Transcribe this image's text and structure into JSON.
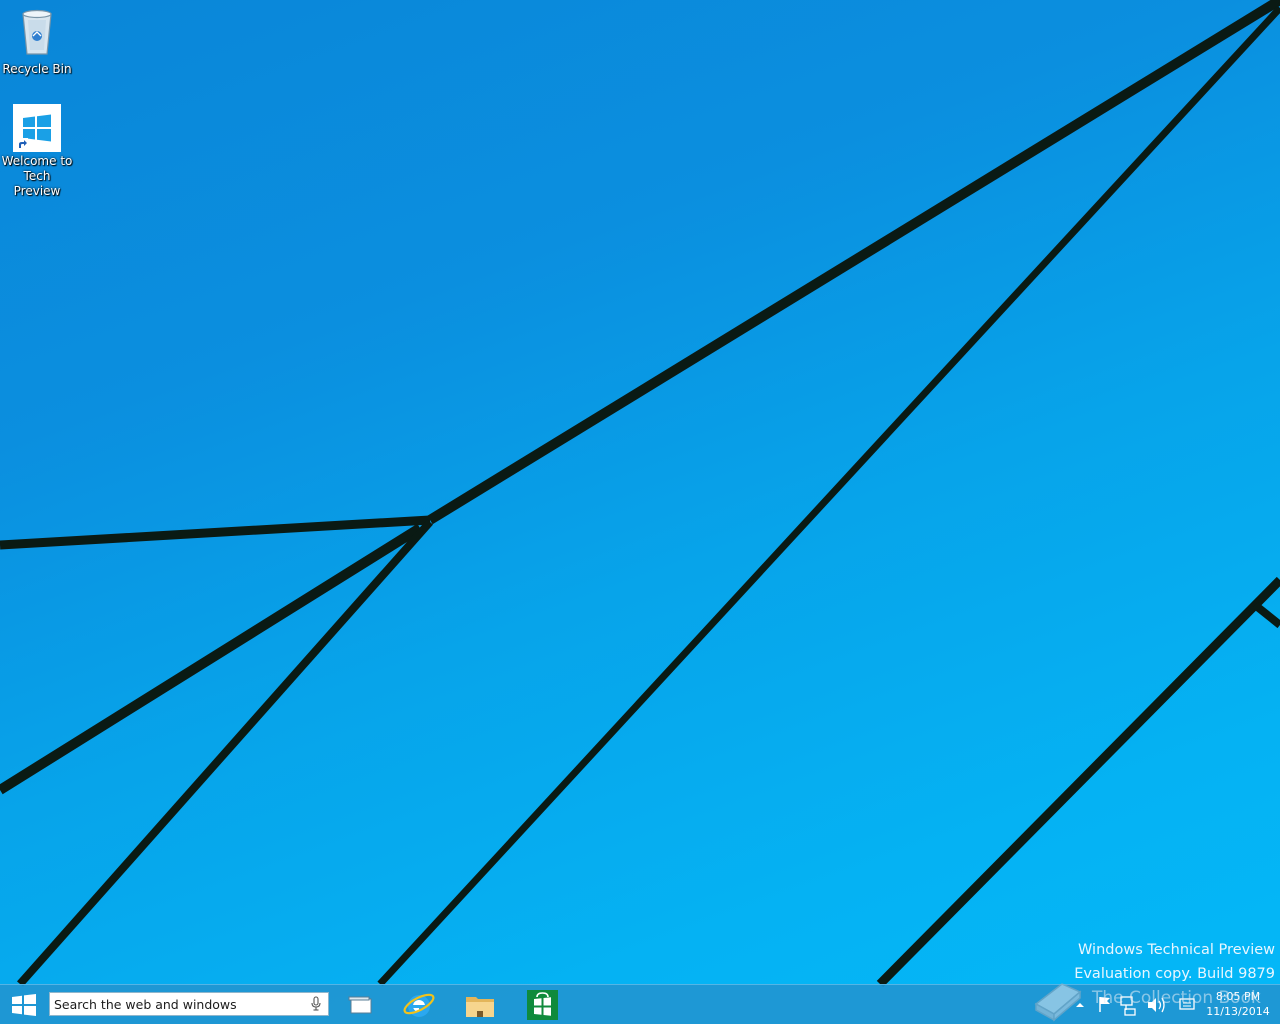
{
  "desktop": {
    "icons": [
      {
        "label": "Recycle Bin",
        "icon": "recycle-bin-icon"
      },
      {
        "label_line1": "Welcome to",
        "label_line2": "Tech Preview",
        "icon": "windows-logo-shortcut-icon"
      }
    ],
    "watermark": {
      "line1": "Windows Technical Preview",
      "line2": "Evaluation copy. Build 9879"
    },
    "overlay_logo_text": "The Collection Book"
  },
  "taskbar": {
    "search_placeholder": "Search the web and windows",
    "pinned_apps": [
      "task-view-icon",
      "internet-explorer-icon",
      "file-explorer-icon",
      "store-icon"
    ],
    "tray": {
      "icons": [
        "show-hidden-icons-chevron",
        "action-center-flag-icon",
        "network-icon",
        "volume-icon",
        "input-indicator-icon"
      ],
      "time": "8:05 PM",
      "date": "11/13/2014"
    }
  },
  "colors": {
    "wallpaper_blue": "#0b8fdf",
    "taskbar": "#2096d2",
    "store_green": "#0f8a3c"
  }
}
